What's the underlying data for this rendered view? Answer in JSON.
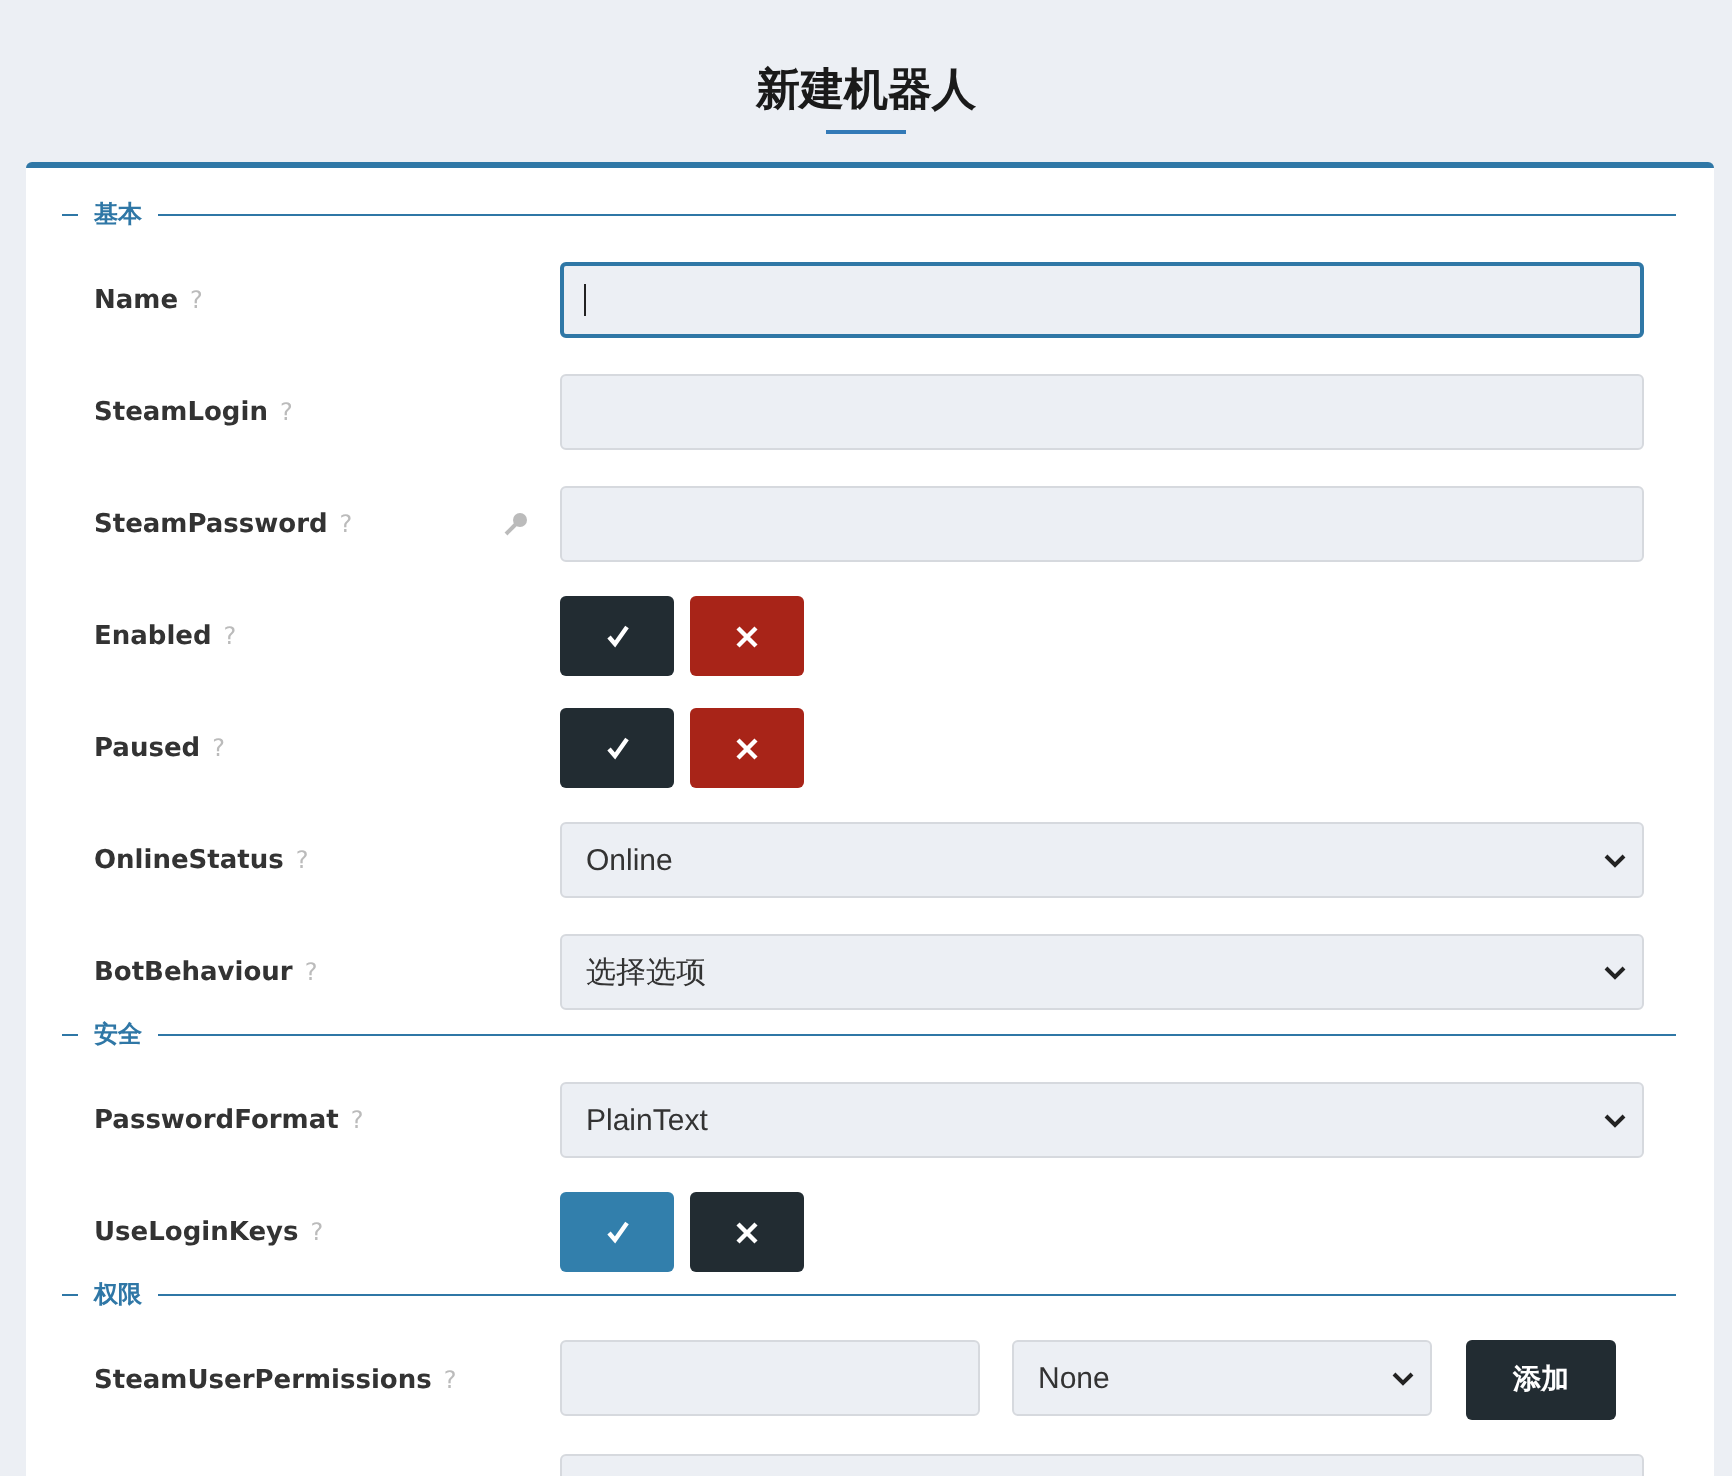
{
  "title": "新建机器人",
  "sections": [
    {
      "title": "基本",
      "rows": [
        {
          "kind": "input",
          "label": "Name",
          "help": "?",
          "focused": true
        },
        {
          "kind": "input",
          "label": "SteamLogin",
          "help": "?",
          "focused": false
        },
        {
          "kind": "password",
          "label": "SteamPassword",
          "help": "?",
          "focused": false
        },
        {
          "kind": "toggle",
          "label": "Enabled",
          "help": "?",
          "value": false
        },
        {
          "kind": "toggle",
          "label": "Paused",
          "help": "?",
          "value": false
        },
        {
          "kind": "select",
          "label": "OnlineStatus",
          "help": "?",
          "value": "Online"
        },
        {
          "kind": "select",
          "label": "BotBehaviour",
          "help": "?",
          "value": "选择选项"
        }
      ]
    },
    {
      "title": "安全",
      "rows": [
        {
          "kind": "select",
          "label": "PasswordFormat",
          "help": "?",
          "value": "PlainText"
        },
        {
          "kind": "toggle",
          "label": "UseLoginKeys",
          "help": "?",
          "value": true
        }
      ]
    },
    {
      "title": "权限",
      "rows": [
        {
          "kind": "permissions",
          "label": "SteamUserPermissions",
          "help": "?",
          "select_value": "None",
          "button": "添加"
        },
        {
          "kind": "input",
          "focused": false
        }
      ]
    }
  ]
}
